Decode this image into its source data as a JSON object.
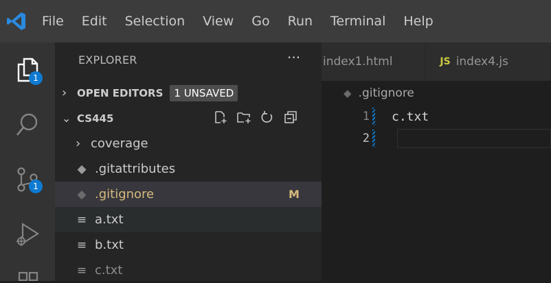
{
  "menu": [
    "File",
    "Edit",
    "Selection",
    "View",
    "Go",
    "Run",
    "Terminal",
    "Help"
  ],
  "activity": {
    "explorer_badge": "1",
    "scm_badge": "1"
  },
  "sidebar": {
    "title": "EXPLORER",
    "more": "···",
    "open_editors": {
      "label": "OPEN EDITORS",
      "badge": "1 UNSAVED"
    },
    "folder": {
      "label": "CS445"
    },
    "items": [
      {
        "label": "coverage",
        "type": "folder"
      },
      {
        "label": ".gitattributes",
        "type": "git"
      },
      {
        "label": ".gitignore",
        "type": "git",
        "status": "M"
      },
      {
        "label": "a.txt",
        "type": "text"
      },
      {
        "label": "b.txt",
        "type": "text"
      },
      {
        "label": "c.txt",
        "type": "text"
      }
    ]
  },
  "tabs": [
    {
      "label": "index1.html"
    },
    {
      "label": "index4.js",
      "icon_text": "JS"
    }
  ],
  "editor": {
    "breadcrumb": ".gitignore",
    "lines": [
      {
        "number": "1",
        "text": "c.txt"
      },
      {
        "number": "2",
        "text": ""
      }
    ]
  },
  "colors": {
    "accent": "#0e7ad1",
    "modified": "#d7ba7d",
    "js_icon": "#cbcb41"
  }
}
